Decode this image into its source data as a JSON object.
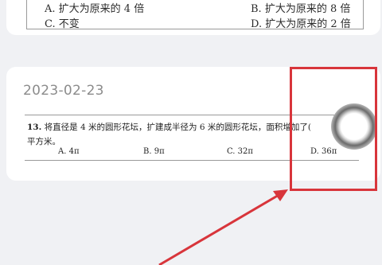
{
  "top_options": {
    "A": "A. 扩大为原来的 4 倍",
    "B": "B. 扩大为原来的 8 倍",
    "C": "C. 不变",
    "D": "D. 扩大为原来的 2 倍"
  },
  "record": {
    "date": "2023-02-23",
    "question_number": "13.",
    "question_line1": "将直径是 4 米的圆形花坛，扩建成半径为 6 米的圆形花坛，面积增加了(",
    "question_line2": "平方米。",
    "options": [
      "A. 4π",
      "B. 9π",
      "C. 32π",
      "D. 36π"
    ]
  },
  "annotation_color": "#d8353b"
}
